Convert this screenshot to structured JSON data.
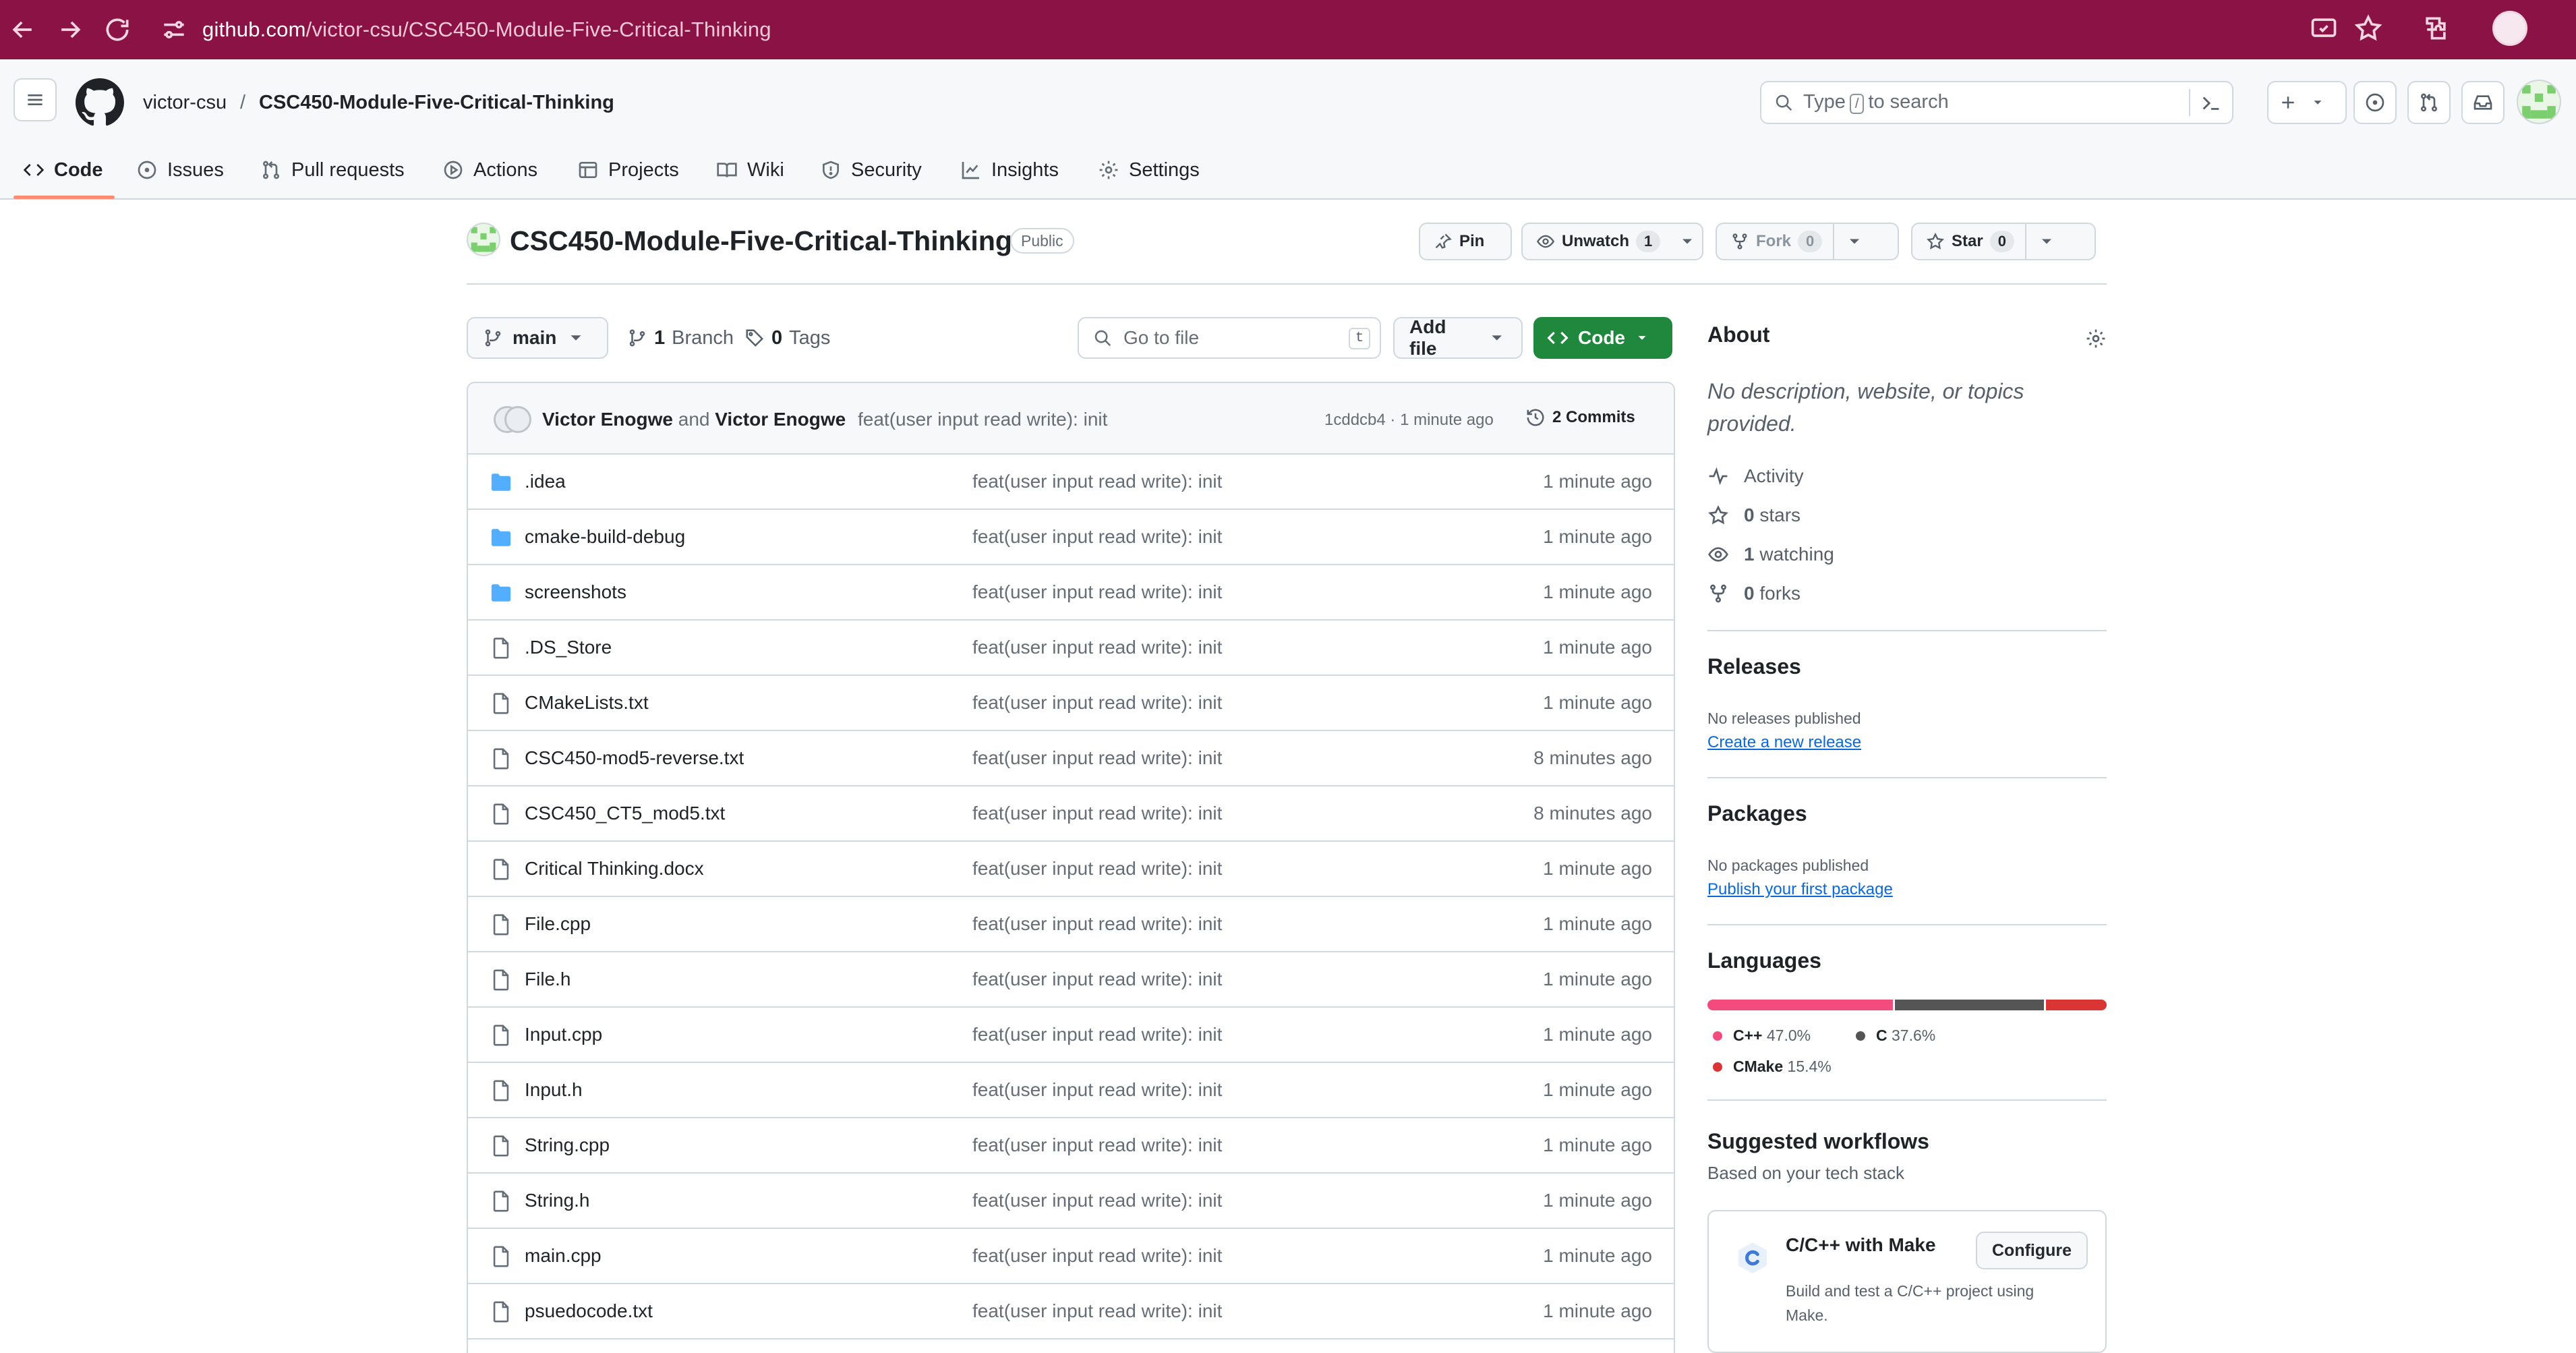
{
  "browser": {
    "url_host": "github.com",
    "url_path": "/victor-csu/CSC450-Module-Five-Critical-Thinking"
  },
  "header": {
    "owner": "victor-csu",
    "separator": "/",
    "repo": "CSC450-Module-Five-Critical-Thinking",
    "search_prefix": "Type",
    "search_key": "/",
    "search_suffix": "to search"
  },
  "nav": {
    "tabs": [
      {
        "label": "Code",
        "icon": "code-icon"
      },
      {
        "label": "Issues",
        "icon": "issue-icon"
      },
      {
        "label": "Pull requests",
        "icon": "pull-request-icon"
      },
      {
        "label": "Actions",
        "icon": "play-icon"
      },
      {
        "label": "Projects",
        "icon": "table-icon"
      },
      {
        "label": "Wiki",
        "icon": "book-icon"
      },
      {
        "label": "Security",
        "icon": "shield-icon"
      },
      {
        "label": "Insights",
        "icon": "graph-icon"
      },
      {
        "label": "Settings",
        "icon": "gear-icon"
      }
    ]
  },
  "repo": {
    "name": "CSC450-Module-Five-Critical-Thinking",
    "visibility": "Public",
    "pin_label": "Pin",
    "watch_label": "Unwatch",
    "watch_count": "1",
    "fork_label": "Fork",
    "fork_count": "0",
    "star_label": "Star",
    "star_count": "0"
  },
  "filenav": {
    "branch": "main",
    "branch_count": "1",
    "branch_label": "Branch",
    "tag_count": "0",
    "tag_label": "Tags",
    "goto_placeholder": "Go to file",
    "goto_key": "t",
    "add_file": "Add file",
    "code": "Code"
  },
  "commit": {
    "author1": "Victor Enogwe",
    "and": "and",
    "author2": "Victor Enogwe",
    "message": "feat(user input read write): init",
    "meta": "1cddcb4 · 1 minute ago",
    "commits": "2 Commits"
  },
  "files": [
    {
      "name": ".idea",
      "type": "folder",
      "message": "feat(user input read write): init",
      "age": "1 minute ago"
    },
    {
      "name": "cmake-build-debug",
      "type": "folder",
      "message": "feat(user input read write): init",
      "age": "1 minute ago"
    },
    {
      "name": "screenshots",
      "type": "folder",
      "message": "feat(user input read write): init",
      "age": "1 minute ago"
    },
    {
      "name": ".DS_Store",
      "type": "file",
      "message": "feat(user input read write): init",
      "age": "1 minute ago"
    },
    {
      "name": "CMakeLists.txt",
      "type": "file",
      "message": "feat(user input read write): init",
      "age": "1 minute ago"
    },
    {
      "name": "CSC450-mod5-reverse.txt",
      "type": "file",
      "message": "feat(user input read write): init",
      "age": "8 minutes ago"
    },
    {
      "name": "CSC450_CT5_mod5.txt",
      "type": "file",
      "message": "feat(user input read write): init",
      "age": "8 minutes ago"
    },
    {
      "name": "Critical Thinking.docx",
      "type": "file",
      "message": "feat(user input read write): init",
      "age": "1 minute ago"
    },
    {
      "name": "File.cpp",
      "type": "file",
      "message": "feat(user input read write): init",
      "age": "1 minute ago"
    },
    {
      "name": "File.h",
      "type": "file",
      "message": "feat(user input read write): init",
      "age": "1 minute ago"
    },
    {
      "name": "Input.cpp",
      "type": "file",
      "message": "feat(user input read write): init",
      "age": "1 minute ago"
    },
    {
      "name": "Input.h",
      "type": "file",
      "message": "feat(user input read write): init",
      "age": "1 minute ago"
    },
    {
      "name": "String.cpp",
      "type": "file",
      "message": "feat(user input read write): init",
      "age": "1 minute ago"
    },
    {
      "name": "String.h",
      "type": "file",
      "message": "feat(user input read write): init",
      "age": "1 minute ago"
    },
    {
      "name": "main.cpp",
      "type": "file",
      "message": "feat(user input read write): init",
      "age": "1 minute ago"
    },
    {
      "name": "psuedocode.txt",
      "type": "file",
      "message": "feat(user input read write): init",
      "age": "1 minute ago"
    }
  ],
  "about": {
    "title": "About",
    "description": "No description, website, or topics provided.",
    "activity": "Activity",
    "stars_count": "0",
    "stars_label": "stars",
    "watching_count": "1",
    "watching_label": "watching",
    "forks_count": "0",
    "forks_label": "forks"
  },
  "releases": {
    "title": "Releases",
    "empty": "No releases published",
    "link": "Create a new release"
  },
  "packages": {
    "title": "Packages",
    "empty": "No packages published",
    "link": "Publish your first package"
  },
  "languages": {
    "title": "Languages",
    "items": [
      {
        "name": "C++",
        "percent": "47.0%",
        "value": 47.0,
        "color": "#f34b7d"
      },
      {
        "name": "C",
        "percent": "37.6%",
        "value": 37.6,
        "color": "#555555"
      },
      {
        "name": "CMake",
        "percent": "15.4%",
        "value": 15.4,
        "color": "#da3434"
      }
    ]
  },
  "workflows": {
    "title": "Suggested workflows",
    "subtitle": "Based on your tech stack",
    "card_title": "C/C++ with Make",
    "card_desc": "Build and test a C/C++ project using Make.",
    "configure": "Configure"
  },
  "colors": {
    "browser_bar": "#8a1245",
    "accent_green": "#1f883d",
    "link_blue": "#0969da",
    "folder_blue": "#54aeff",
    "tab_underline": "#fd8c73"
  }
}
